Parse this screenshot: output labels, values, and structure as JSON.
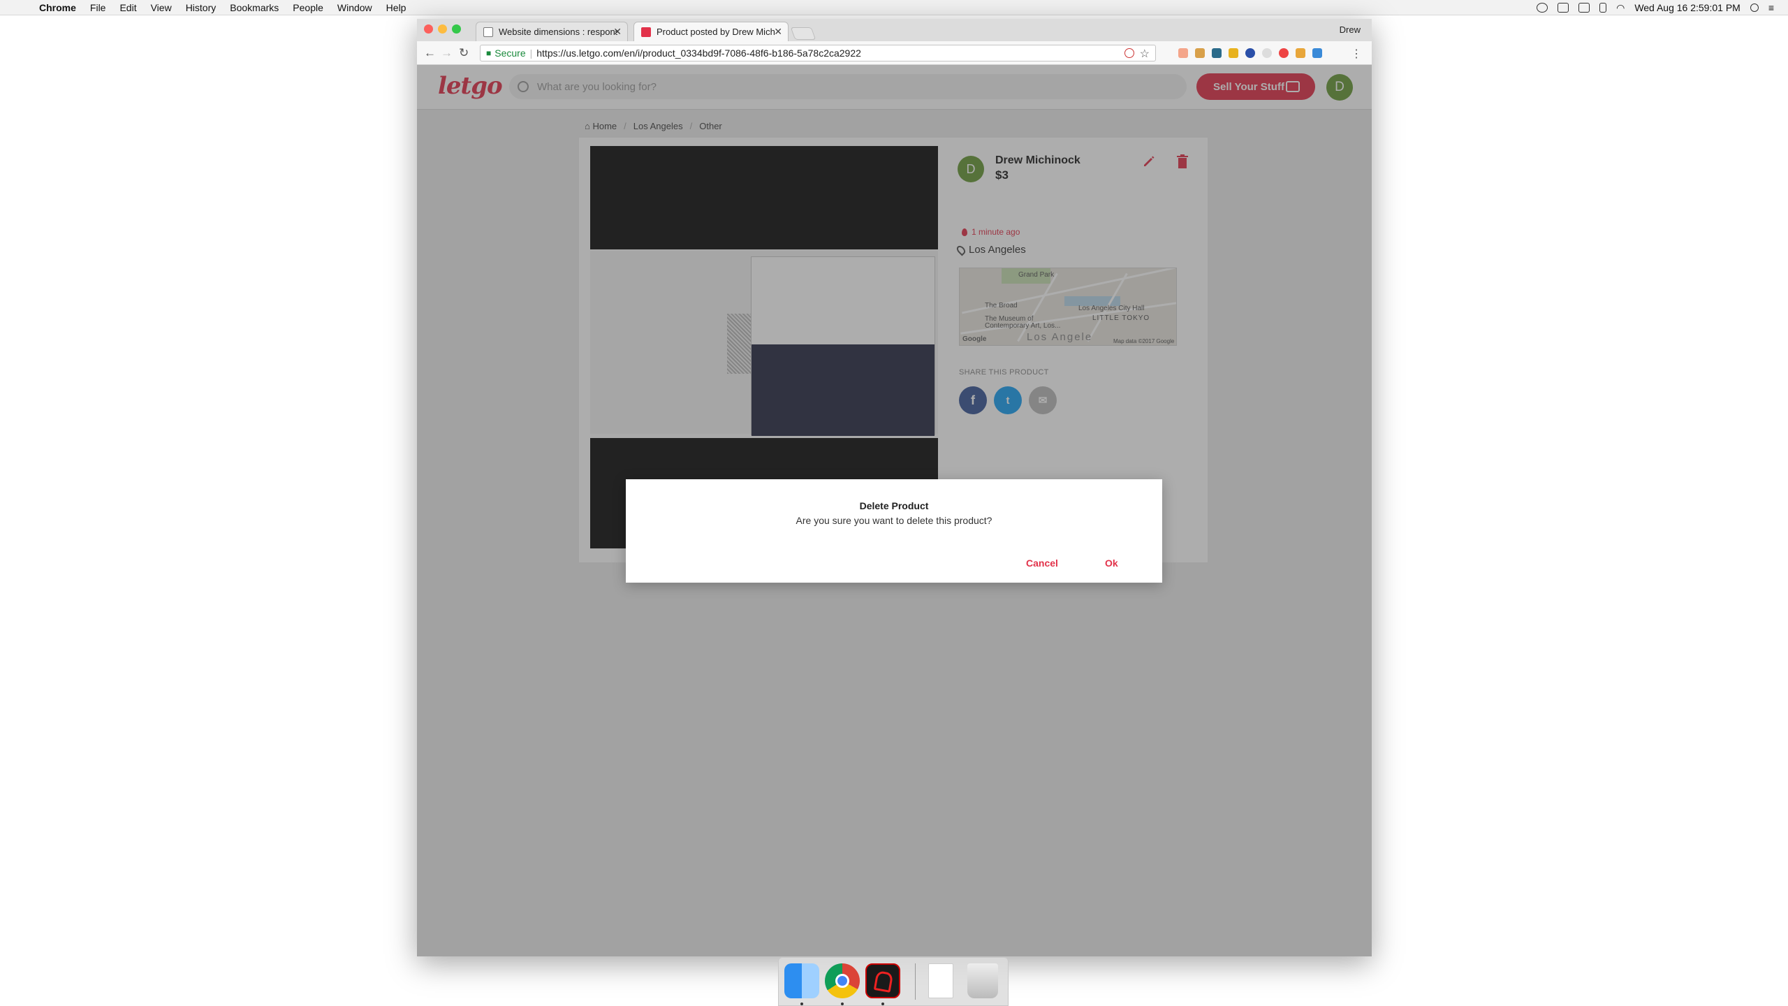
{
  "menubar": {
    "app": "Chrome",
    "items": [
      "File",
      "Edit",
      "View",
      "History",
      "Bookmarks",
      "People",
      "Window",
      "Help"
    ],
    "clock": "Wed Aug 16  2:59:01 PM"
  },
  "browser": {
    "tabs": [
      {
        "title": "Website dimensions : respons"
      },
      {
        "title": "Product posted by Drew Michi"
      }
    ],
    "profile": "Drew",
    "secure_label": "Secure",
    "url": "https://us.letgo.com/en/i/product_0334bd9f-7086-48f6-b186-5a78c2ca2922"
  },
  "site": {
    "logo": "letgo",
    "search_placeholder": "What are you looking for?",
    "sell_button": "Sell Your Stuff",
    "user_initial": "D",
    "brand_color": "#e2324a"
  },
  "breadcrumb": [
    "Home",
    "Los Angeles",
    "Other"
  ],
  "product": {
    "seller_initial": "D",
    "seller_name": "Drew Michinock",
    "price": "$3",
    "posted": "1 minute ago",
    "location": "Los Angeles",
    "share_label": "SHARE THIS PRODUCT",
    "map": {
      "labels": [
        "Grand Park",
        "The Broad",
        "The Museum of Contemporary Art, Los...",
        "Los Angeles City Hall",
        "LITTLE TOKYO",
        "Los Angele",
        "Google",
        "Map data ©2017 Google"
      ]
    }
  },
  "dialog": {
    "title": "Delete Product",
    "message": "Are you sure you want to delete this product?",
    "cancel": "Cancel",
    "ok": "Ok"
  }
}
